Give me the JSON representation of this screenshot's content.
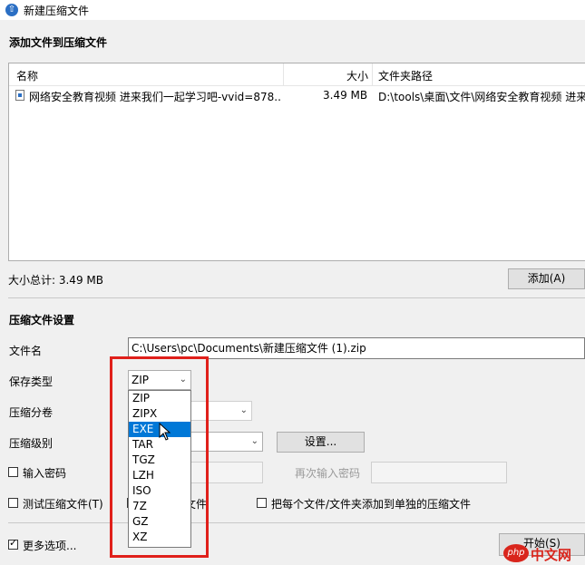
{
  "window": {
    "title": "新建压缩文件"
  },
  "add_section": {
    "title": "添加文件到压缩文件",
    "columns": {
      "name": "名称",
      "size": "大小",
      "path": "文件夹路径"
    },
    "files": [
      {
        "name": "网络安全教育视频 进来我们一起学习吧-vvid=878...",
        "size": "3.49 MB",
        "path": "D:\\tools\\桌面\\文件\\网络安全教育视频 进来"
      }
    ],
    "total_label": "大小总计: 3.49 MB",
    "add_button": "添加(A)"
  },
  "settings": {
    "title": "压缩文件设置",
    "filename_label": "文件名",
    "filename_value": "C:\\Users\\pc\\Documents\\新建压缩文件 (1).zip",
    "type_label": "保存类型",
    "type_value": "ZIP",
    "split_label": "压缩分卷",
    "level_label": "压缩级别",
    "settings_button": "设置...",
    "password_label": "输入密码",
    "reenter_label": "再次输入密码",
    "test_label": "测试压缩文件(T)",
    "delete_label": "删除原始文件",
    "each_label": "把每个文件/文件夹添加到单独的压缩文件",
    "more_label": "更多选项...",
    "start_button": "开始(S)"
  },
  "dropdown": {
    "options": [
      "ZIP",
      "ZIPX",
      "EXE",
      "TAR",
      "TGZ",
      "LZH",
      "ISO",
      "7Z",
      "GZ",
      "XZ"
    ],
    "highlighted_index": 2
  },
  "watermark": {
    "text": "中文网",
    "prefix": "php"
  },
  "colors": {
    "highlight": "#0078d7",
    "annotation_red": "#e0201b",
    "logo_red": "#d9251c"
  }
}
